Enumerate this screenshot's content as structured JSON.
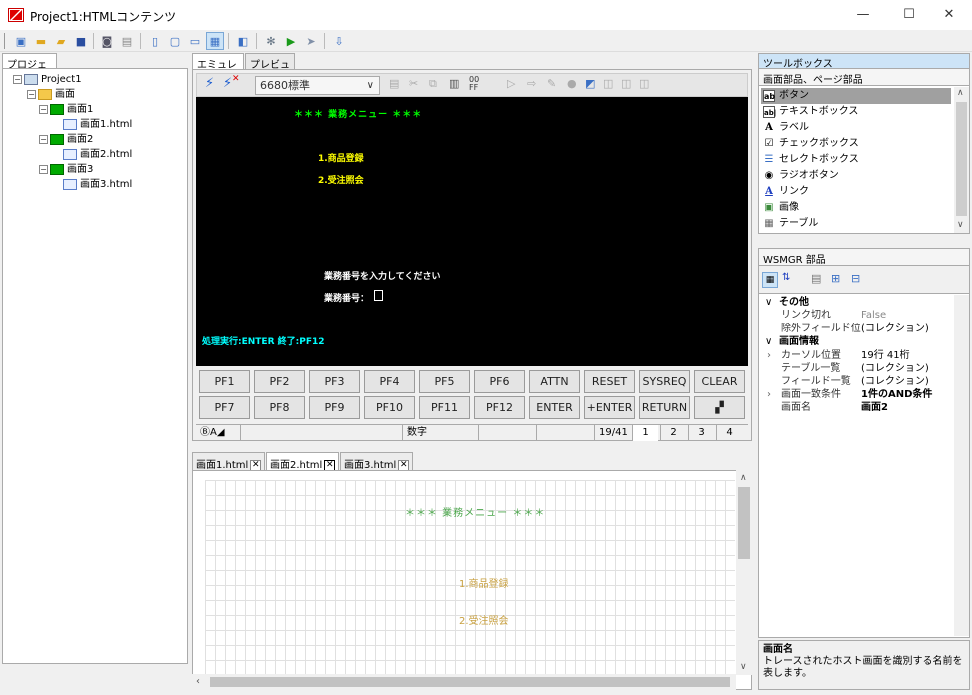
{
  "window": {
    "title": "Project1:HTMLコンテンツ",
    "minimize": "—",
    "maximize": "☐",
    "close": "✕"
  },
  "project_panel": {
    "tab": "プロジェクト",
    "tree": [
      {
        "label": "Project1",
        "icon": "project-icon"
      },
      {
        "label": "画面",
        "icon": "folder-icon"
      },
      {
        "label": "画面1",
        "icon": "screen-icon"
      },
      {
        "label": "画面1.html",
        "icon": "html-file-icon"
      },
      {
        "label": "画面2",
        "icon": "screen-icon"
      },
      {
        "label": "画面2.html",
        "icon": "html-file-icon"
      },
      {
        "label": "画面3",
        "icon": "screen-icon"
      },
      {
        "label": "画面3.html",
        "icon": "html-file-icon"
      }
    ]
  },
  "center_tabs": {
    "emulator": "エミュレータ",
    "preview": "プレビュー"
  },
  "emulator": {
    "mode": "6680標準",
    "screen": {
      "title": "＊＊＊  業務メニュー  ＊＊＊",
      "item1": "1.商品登録",
      "item2": "2.受注照会",
      "prompt": "業務番号を入力してください",
      "field_label": "業務番号：",
      "footer": "処理実行:ENTER   終了:PF12"
    },
    "keys_row1": [
      "PF1",
      "PF2",
      "PF3",
      "PF4",
      "PF5",
      "PF6",
      "ATTN",
      "RESET",
      "SYSREQ",
      "CLEAR"
    ],
    "keys_row2": [
      "PF7",
      "PF8",
      "PF9",
      "PF10",
      "PF11",
      "PF12",
      "ENTER",
      "+ENTER",
      "RETURN",
      ""
    ],
    "status": {
      "indicator": "ⒷA◢",
      "mode": "数字",
      "position": "19/41",
      "s1": "1",
      "s2": "2",
      "s3": "3",
      "s4": "4"
    }
  },
  "doc_tabs": [
    {
      "label": "画面1.html",
      "close": "✕"
    },
    {
      "label": "画面2.html",
      "close": "✕"
    },
    {
      "label": "画面3.html",
      "close": "✕"
    }
  ],
  "designer": {
    "title": "＊＊＊  業務メニュー  ＊＊＊",
    "item1": "1.商品登録",
    "item2": "2.受注照会"
  },
  "toolbox": {
    "header": "ツールボックス",
    "sub": "画面部品、ページ部品",
    "items": [
      {
        "label": "ボタン",
        "icon": "ab"
      },
      {
        "label": "テキストボックス",
        "icon": "ab|"
      },
      {
        "label": "ラベル",
        "icon": "A"
      },
      {
        "label": "チェックボックス",
        "icon": "☑"
      },
      {
        "label": "セレクトボックス",
        "icon": "☰"
      },
      {
        "label": "ラジオボタン",
        "icon": "◉"
      },
      {
        "label": "リンク",
        "icon": "A"
      },
      {
        "label": "画像",
        "icon": "▣"
      },
      {
        "label": "テーブル",
        "icon": "▦"
      }
    ]
  },
  "properties": {
    "header": "WSMGR 部品",
    "rows": [
      {
        "name": "その他",
        "value": "",
        "cat": true,
        "mark": "∨"
      },
      {
        "name": "リンク切れ",
        "value": "False"
      },
      {
        "name": "除外フィールド位置",
        "value": "(コレクション)"
      },
      {
        "name": "画面情報",
        "value": "",
        "cat": true,
        "mark": "∨"
      },
      {
        "name": "カーソル位置",
        "value": "19行 41桁",
        "mark": "›"
      },
      {
        "name": "テーブル一覧",
        "value": "(コレクション)"
      },
      {
        "name": "フィールド一覧",
        "value": "(コレクション)"
      },
      {
        "name": "画面一致条件",
        "value": "1件のAND条件",
        "mark": "›"
      },
      {
        "name": "画面名",
        "value": "画面2"
      }
    ],
    "desc_title": "画面名",
    "desc_text": "トレースされたホスト画面を識別する名前を表します。"
  },
  "colors": {
    "screen_bg": "#000000",
    "green": "#00ff00",
    "yellow": "#ffff00",
    "cyan": "#00ffff",
    "white": "#ffffff",
    "designer_text": "#4aa54a",
    "designer_item": "#c8a040"
  }
}
